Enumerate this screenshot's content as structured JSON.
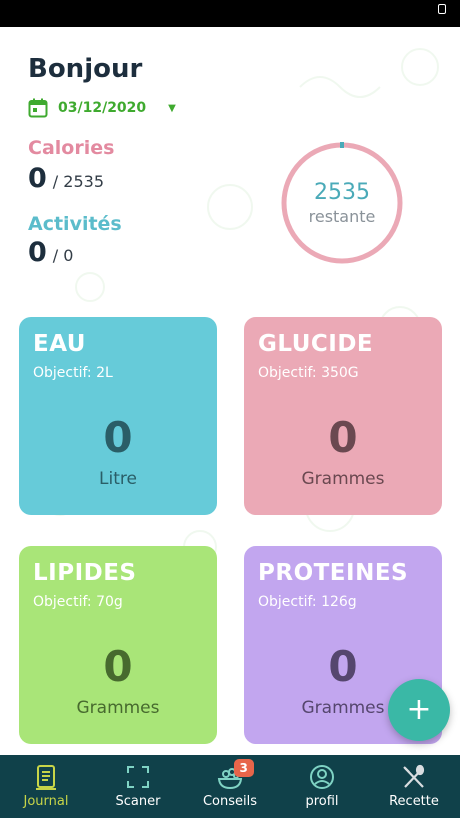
{
  "header": {
    "greeting": "Bonjour",
    "date": "03/12/2020"
  },
  "calories": {
    "label": "Calories",
    "value": "0",
    "goal": "/ 2535",
    "color": "#e38aa0"
  },
  "activites": {
    "label": "Activités",
    "value": "0",
    "goal": "/ 0",
    "color": "#5bbccb"
  },
  "ring": {
    "value": "2535",
    "label": "restante",
    "progress": 0.0
  },
  "cards": [
    {
      "title": "EAU",
      "goal": "Objectif: 2L",
      "value": "0",
      "unit": "Litre",
      "color": "#66cbd9"
    },
    {
      "title": "GLUCIDE",
      "goal": "Objectif: 350G",
      "value": "0",
      "unit": "Grammes",
      "color": "#eba9b6"
    },
    {
      "title": "LIPIDES",
      "goal": "Objectif: 70g",
      "value": "0",
      "unit": "Grammes",
      "color": "#a9e578"
    },
    {
      "title": "PROTEINES",
      "goal": "Objectif: 126g",
      "value": "0",
      "unit": "Grammes",
      "color": "#c2a6ef"
    }
  ],
  "fab": {
    "icon": "plus-icon"
  },
  "tabbar": {
    "items": [
      {
        "label": "Journal",
        "icon": "journal-icon",
        "active": true
      },
      {
        "label": "Scaner",
        "icon": "scan-icon",
        "active": false
      },
      {
        "label": "Conseils",
        "icon": "conseils-icon",
        "active": false,
        "badge": "3"
      },
      {
        "label": "profil",
        "icon": "profile-icon",
        "active": false
      },
      {
        "label": "Recette",
        "icon": "recipe-icon",
        "active": false
      }
    ]
  },
  "colors": {
    "tabbar_bg": "#10414a",
    "active_tab": "#c7d548",
    "accent_green": "#3faa2f",
    "fab": "#3ab8a6"
  }
}
